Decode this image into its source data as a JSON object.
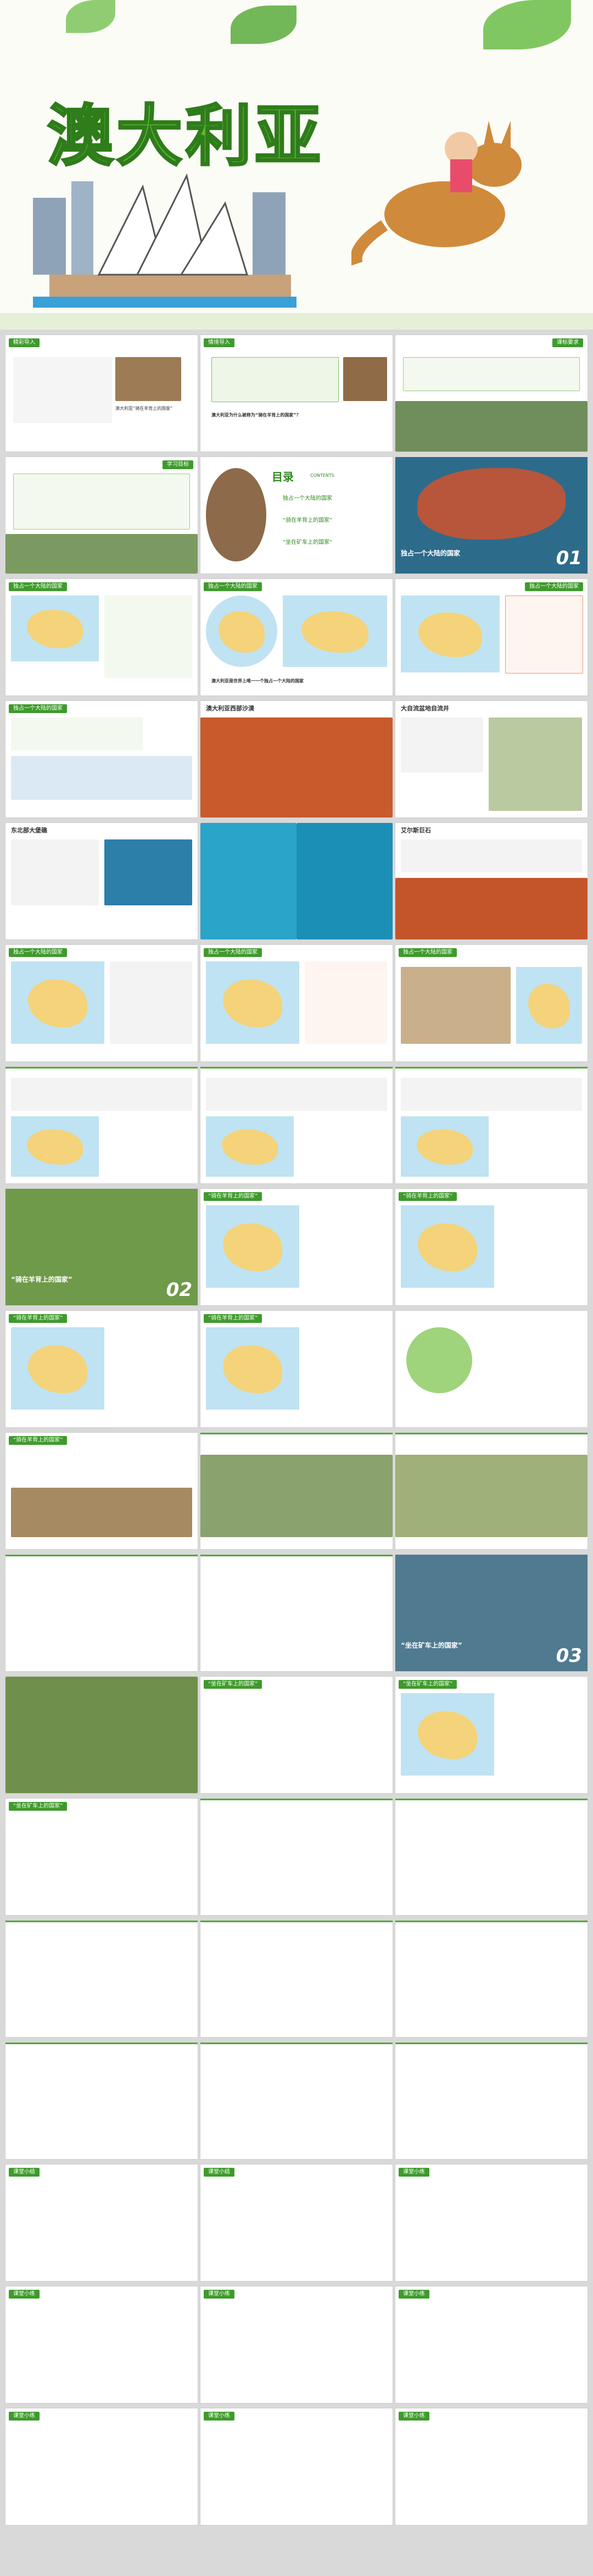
{
  "hero": {
    "title": "澳大利亚"
  },
  "slides": {
    "s1": {
      "header": "精彩导入",
      "caption": "澳大利亚“骑在羊背上的国家”"
    },
    "s2": {
      "header": "情境导入",
      "text": "澳大利亚为什么被称为“骑在羊背上的国家”？"
    },
    "s3": {
      "header": "课标要求"
    },
    "s4": {
      "header": "学习目标"
    },
    "s5": {
      "title": "目录",
      "sub": "CONTENTS",
      "items": [
        "独占一个大陆的国家",
        "“骑在羊背上的国家”",
        "“坐在矿车上的国家”"
      ]
    },
    "s6": {
      "title": "独占一个大陆的国家",
      "num": "01"
    },
    "s7": {
      "header": "独占一个大陆的国家"
    },
    "s8": {
      "header": "独占一个大陆的国家",
      "text": "澳大利亚是世界上唯一一个独占一个大陆的国家"
    },
    "s9": {
      "header": "独占一个大陆的国家"
    },
    "s10": {
      "header": "澳大利亚西部沙漠"
    },
    "s11": {
      "header": "大自流盆地自流井"
    },
    "s12": {
      "header": "东北部大堡礁"
    },
    "s13": {
      "header": "艾尔斯巨石"
    },
    "s14": {
      "header": "独占一个大陆的国家"
    },
    "s15": {
      "header": "独占一个大陆的国家"
    },
    "s16": {
      "header": "独占一个大陆的国家"
    },
    "s17": {
      "title": "“骑在羊背上的国家”",
      "num": "02"
    },
    "s18": {
      "header": "“骑在羊背上的国家”"
    },
    "s19": {
      "header": "“骑在羊背上的国家”"
    },
    "s20": {
      "title": "“坐在矿车上的国家”",
      "num": "03"
    },
    "s21": {
      "header": "“坐在矿车上的国家”"
    },
    "s22": {
      "header": "课堂小结"
    },
    "s23": {
      "header": "课堂小练"
    }
  }
}
